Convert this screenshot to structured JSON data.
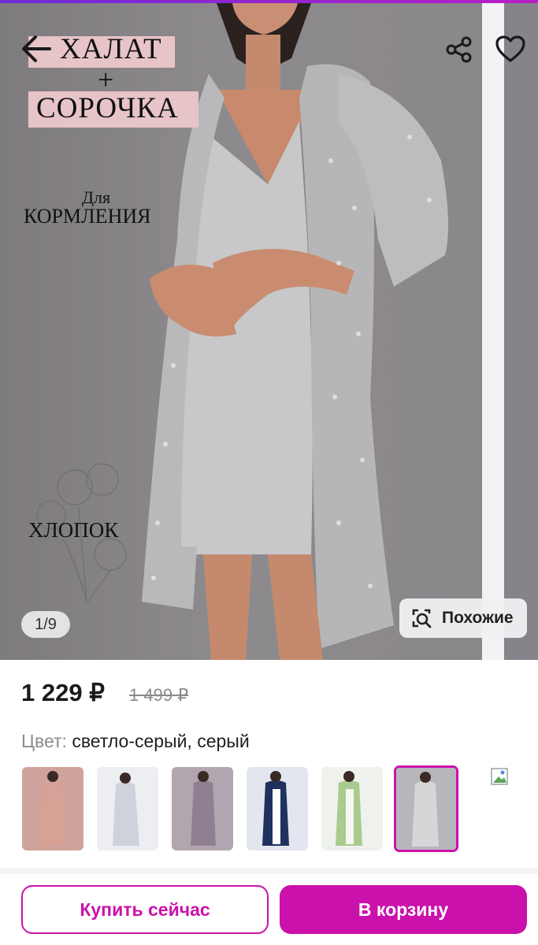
{
  "hero": {
    "promo_line1": "ХАЛАТ",
    "promo_plus": "+",
    "promo_line2": "СОРОЧКА",
    "promo_small1": "Для",
    "promo_small2": "КОРМЛЕНИЯ",
    "promo_cotton": "ХЛОПОК",
    "counter": "1/9",
    "similar_label": "Похожие"
  },
  "product": {
    "price": "1 229 ₽",
    "old_price": "1 499 ₽",
    "color_label": "Цвет:",
    "color_value": " светло-серый, серый"
  },
  "thumbnails": [
    {
      "color": "#c9928a",
      "dress": "#d7a39a"
    },
    {
      "color": "#e8e8ec",
      "dress": "#c9ccd4"
    },
    {
      "color": "#a89aa8",
      "dress": "#8e7f90"
    },
    {
      "color": "#dde0e8",
      "dress": "#1e2f5c"
    },
    {
      "color": "#e9ede6",
      "dress": "#a6c98c"
    },
    {
      "color": "#b9b9bd",
      "dress": "#d4d4d6"
    }
  ],
  "actions": {
    "buy_now": "Купить сейчас",
    "add_to_cart": "В корзину"
  },
  "colors": {
    "accent": "#cb11ab"
  }
}
